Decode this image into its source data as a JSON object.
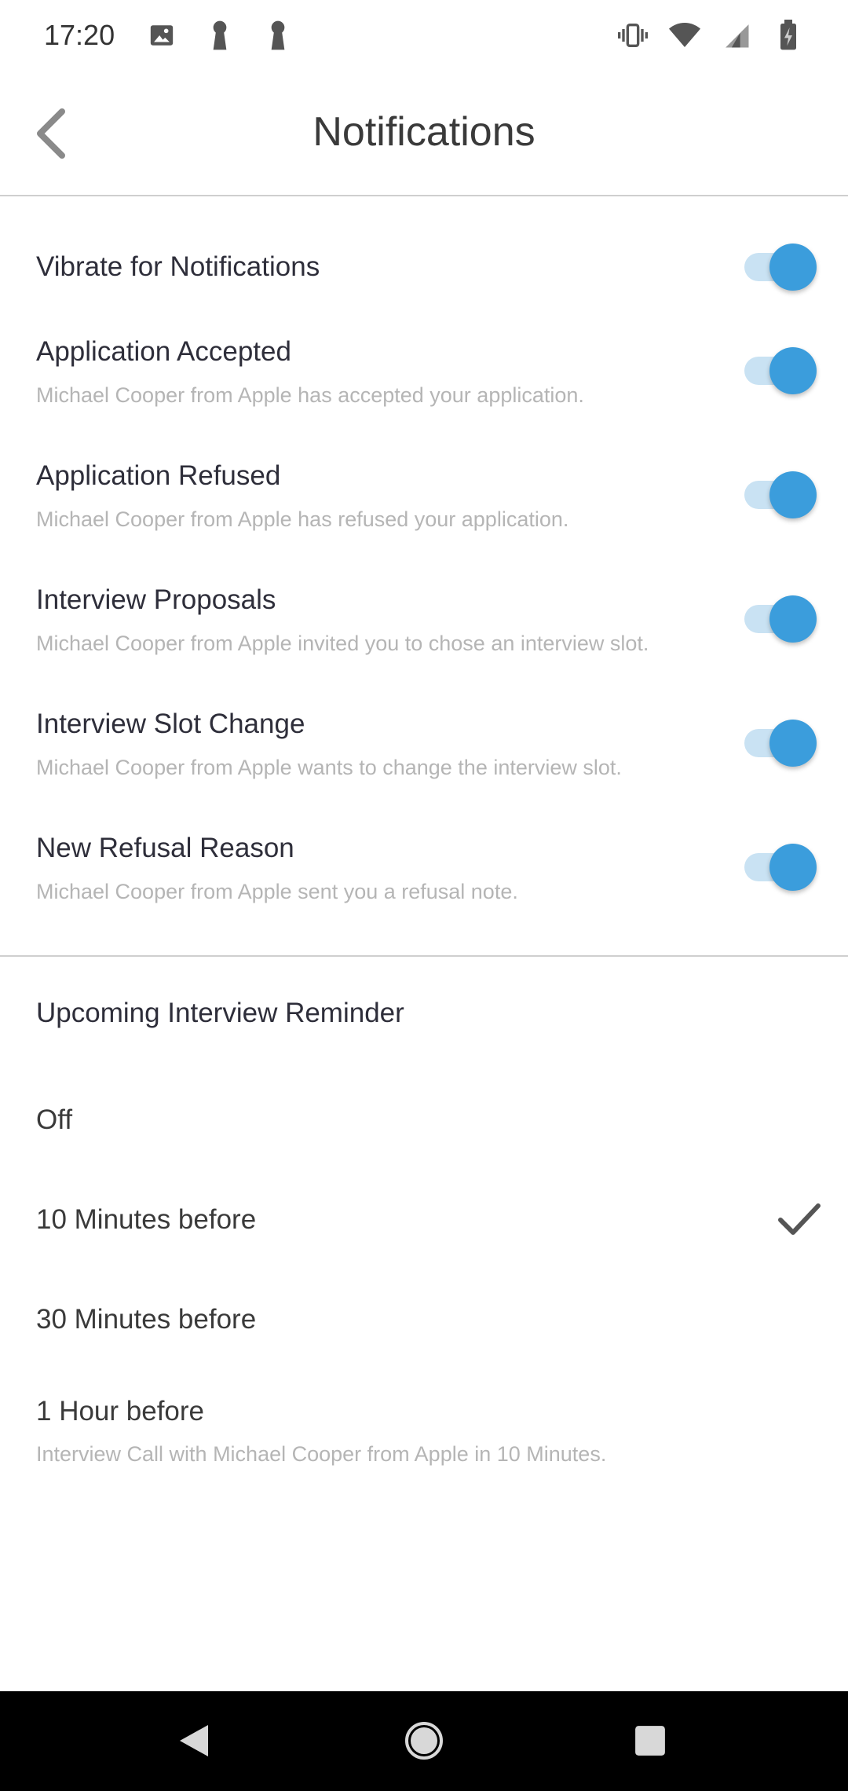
{
  "status_bar": {
    "time": "17:20",
    "left_icons": [
      "image-icon",
      "keyhole-icon",
      "keyhole-icon"
    ],
    "right_icons": [
      "vibrate-icon",
      "wifi-icon",
      "signal-icon",
      "battery-charging-icon"
    ]
  },
  "header": {
    "title": "Notifications",
    "back_icon": "chevron-left-icon"
  },
  "settings": [
    {
      "title": "Vibrate for Notifications",
      "subtitle": "",
      "enabled": true
    },
    {
      "title": "Application Accepted",
      "subtitle": "Michael Cooper from Apple has accepted your application.",
      "enabled": true
    },
    {
      "title": "Application Refused",
      "subtitle": "Michael Cooper from Apple has refused your application.",
      "enabled": true
    },
    {
      "title": "Interview Proposals",
      "subtitle": "Michael Cooper from Apple invited you to chose an interview slot.",
      "enabled": true
    },
    {
      "title": "Interview Slot Change",
      "subtitle": "Michael Cooper from Apple wants to change the interview slot.",
      "enabled": true
    },
    {
      "title": "New Refusal Reason",
      "subtitle": "Michael Cooper from Apple sent you a refusal note.",
      "enabled": true
    }
  ],
  "reminder": {
    "heading": "Upcoming Interview Reminder",
    "options": [
      {
        "label": "Off",
        "selected": false
      },
      {
        "label": "10 Minutes before",
        "selected": true
      },
      {
        "label": "30 Minutes before",
        "selected": false
      },
      {
        "label": "1 Hour before",
        "selected": false
      }
    ],
    "preview_note": "Interview Call with Michael Cooper from Apple in 10 Minutes."
  },
  "colors": {
    "accent": "#3b9ddc",
    "track": "#c9e2f3",
    "title_text": "#2e2e3a",
    "subtitle_text": "#b5b5b5",
    "divider": "#cfcfcf"
  },
  "nav_bar": {
    "icons": [
      "back-triangle-icon",
      "home-circle-icon",
      "recents-square-icon"
    ]
  }
}
